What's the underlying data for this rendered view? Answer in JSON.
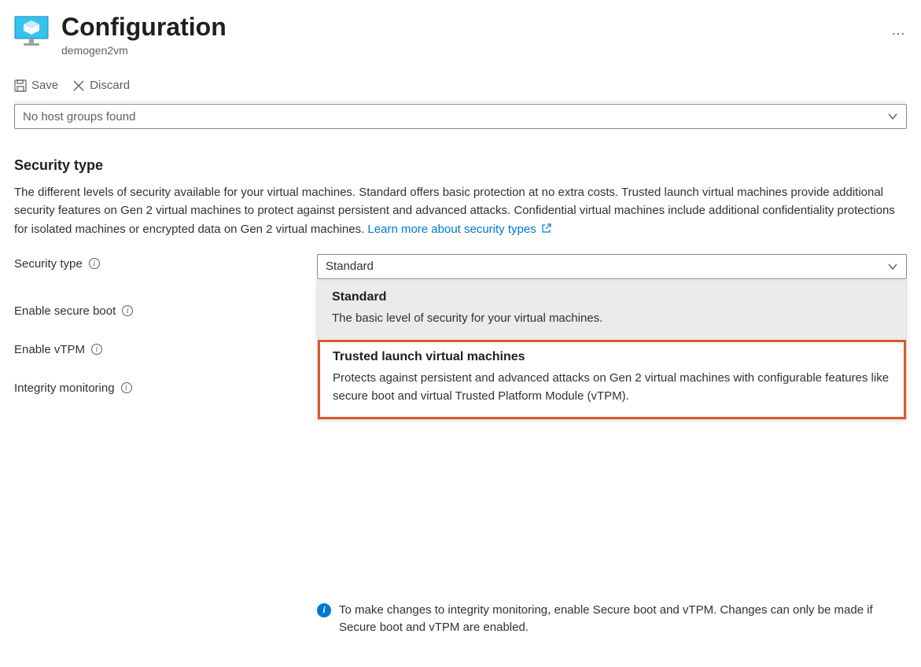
{
  "header": {
    "title": "Configuration",
    "subtitle": "demogen2vm"
  },
  "toolbar": {
    "save_label": "Save",
    "discard_label": "Discard"
  },
  "host_group": {
    "value": "No host groups found"
  },
  "security": {
    "section_title": "Security type",
    "description": "The different levels of security available for your virtual machines. Standard offers basic protection at no extra costs. Trusted launch virtual machines provide additional security features on Gen 2 virtual machines to protect against persistent and advanced attacks. Confidential virtual machines include additional confidentiality protections for isolated machines or encrypted data on Gen 2 virtual machines. ",
    "learn_more": "Learn more about security types",
    "fields": {
      "security_type": {
        "label": "Security type",
        "value": "Standard",
        "options": [
          {
            "title": "Standard",
            "desc": "The basic level of security for your virtual machines."
          },
          {
            "title": "Trusted launch virtual machines",
            "desc": "Protects against persistent and advanced attacks on Gen 2 virtual machines with configurable features like secure boot and virtual Trusted Platform Module (vTPM)."
          }
        ]
      },
      "secure_boot": {
        "label": "Enable secure boot"
      },
      "vtpm": {
        "label": "Enable vTPM"
      },
      "integrity": {
        "label": "Integrity monitoring"
      },
      "integrity_callout": "To make changes to integrity monitoring, enable Secure boot and vTPM. Changes can only be made if Secure boot and vTPM are enabled."
    }
  }
}
